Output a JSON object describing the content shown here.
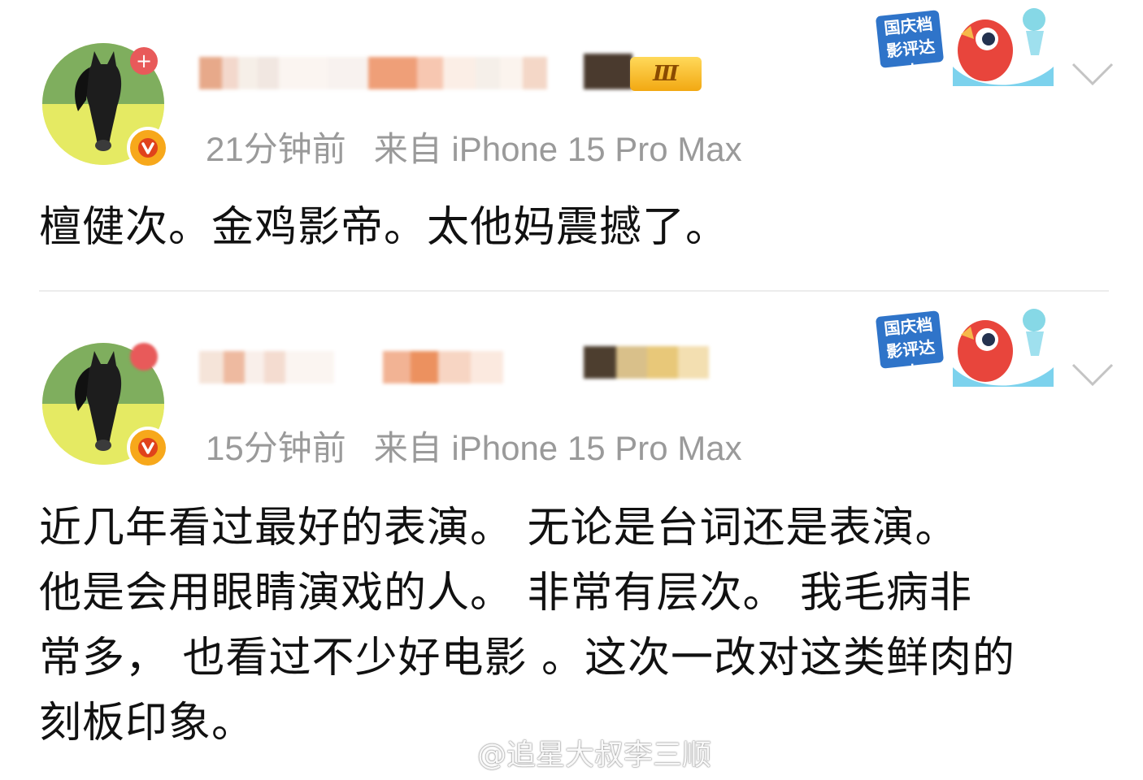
{
  "posts": [
    {
      "time": "21分钟前",
      "source": "来自 iPhone 15 Pro Max",
      "level_badge": "Ⅲ",
      "award_badge": "国庆档影评达人",
      "content_lines": [
        "檀健次。金鸡影帝。太他妈震撼了。"
      ]
    },
    {
      "time": "15分钟前",
      "source": "来自 iPhone 15 Pro Max",
      "award_badge": "国庆档影评达人",
      "content_lines": [
        "近几年看过最好的表演。 无论是台词还是表演。",
        "他是会用眼睛演戏的人。 非常有层次。 我毛病非",
        "常多， 也看过不少好电影 。这次一改对这类鲜肉的",
        "刻板印象。"
      ]
    }
  ],
  "watermark": "@追星大叔李三顺",
  "colors": {
    "meta_text": "#9a9a9a",
    "verified": "#f7a81b",
    "plus_badge": "#e85a5a",
    "level_badge": "#f2a812"
  },
  "icons": [
    "horse-avatar",
    "verified-icon",
    "plus-icon",
    "chevron-down-icon",
    "mascot-icon",
    "weibo-logo-icon"
  ]
}
